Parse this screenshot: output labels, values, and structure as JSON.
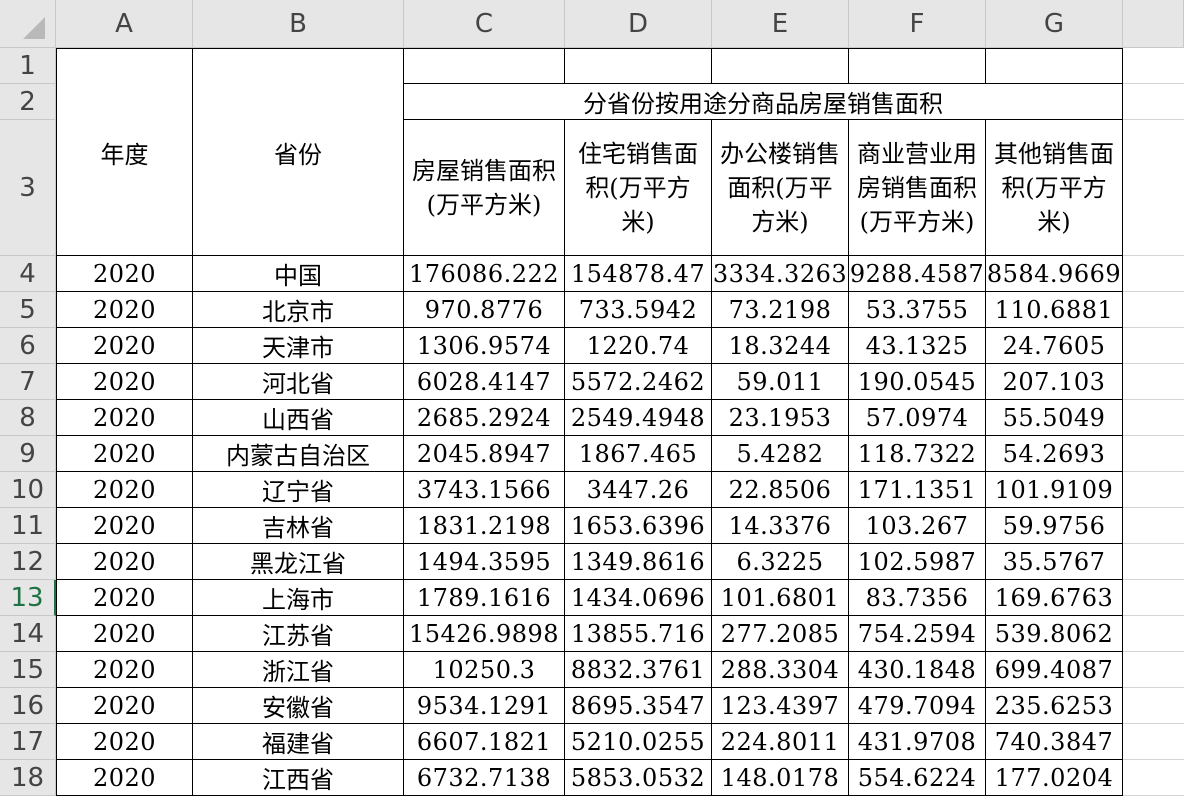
{
  "columns": [
    "A",
    "B",
    "C",
    "D",
    "E",
    "F",
    "G"
  ],
  "row_numbers": [
    "1",
    "2",
    "3",
    "4",
    "5",
    "6",
    "7",
    "8",
    "9",
    "10",
    "11",
    "12",
    "13",
    "14",
    "15",
    "16",
    "17",
    "18"
  ],
  "active_row": "13",
  "header": {
    "year": "年度",
    "province": "省份",
    "group_title": "分省份按用途分商品房屋销售面积",
    "c_total": "房屋销售面积(万平方米)",
    "d_residential": "住宅销售面积(万平方米)",
    "e_office": "办公楼销售面积(万平方米)",
    "f_commercial": "商业营业用房销售面积(万平方米)",
    "g_other": "其他销售面积(万平方米)"
  },
  "rows": [
    {
      "year": "2020",
      "province": "中国",
      "c": "176086.222",
      "d": "154878.47",
      "e": "3334.3263",
      "f": "9288.4587",
      "g": "8584.9669"
    },
    {
      "year": "2020",
      "province": "北京市",
      "c": "970.8776",
      "d": "733.5942",
      "e": "73.2198",
      "f": "53.3755",
      "g": "110.6881"
    },
    {
      "year": "2020",
      "province": "天津市",
      "c": "1306.9574",
      "d": "1220.74",
      "e": "18.3244",
      "f": "43.1325",
      "g": "24.7605"
    },
    {
      "year": "2020",
      "province": "河北省",
      "c": "6028.4147",
      "d": "5572.2462",
      "e": "59.011",
      "f": "190.0545",
      "g": "207.103"
    },
    {
      "year": "2020",
      "province": "山西省",
      "c": "2685.2924",
      "d": "2549.4948",
      "e": "23.1953",
      "f": "57.0974",
      "g": "55.5049"
    },
    {
      "year": "2020",
      "province": "内蒙古自治区",
      "c": "2045.8947",
      "d": "1867.465",
      "e": "5.4282",
      "f": "118.7322",
      "g": "54.2693"
    },
    {
      "year": "2020",
      "province": "辽宁省",
      "c": "3743.1566",
      "d": "3447.26",
      "e": "22.8506",
      "f": "171.1351",
      "g": "101.9109"
    },
    {
      "year": "2020",
      "province": "吉林省",
      "c": "1831.2198",
      "d": "1653.6396",
      "e": "14.3376",
      "f": "103.267",
      "g": "59.9756"
    },
    {
      "year": "2020",
      "province": "黑龙江省",
      "c": "1494.3595",
      "d": "1349.8616",
      "e": "6.3225",
      "f": "102.5987",
      "g": "35.5767"
    },
    {
      "year": "2020",
      "province": "上海市",
      "c": "1789.1616",
      "d": "1434.0696",
      "e": "101.6801",
      "f": "83.7356",
      "g": "169.6763"
    },
    {
      "year": "2020",
      "province": "江苏省",
      "c": "15426.9898",
      "d": "13855.716",
      "e": "277.2085",
      "f": "754.2594",
      "g": "539.8062"
    },
    {
      "year": "2020",
      "province": "浙江省",
      "c": "10250.3",
      "d": "8832.3761",
      "e": "288.3304",
      "f": "430.1848",
      "g": "699.4087"
    },
    {
      "year": "2020",
      "province": "安徽省",
      "c": "9534.1291",
      "d": "8695.3547",
      "e": "123.4397",
      "f": "479.7094",
      "g": "235.6253"
    },
    {
      "year": "2020",
      "province": "福建省",
      "c": "6607.1821",
      "d": "5210.0255",
      "e": "224.8011",
      "f": "431.9708",
      "g": "740.3847"
    },
    {
      "year": "2020",
      "province": "江西省",
      "c": "6732.7138",
      "d": "5853.0532",
      "e": "148.0178",
      "f": "554.6224",
      "g": "177.0204"
    }
  ]
}
